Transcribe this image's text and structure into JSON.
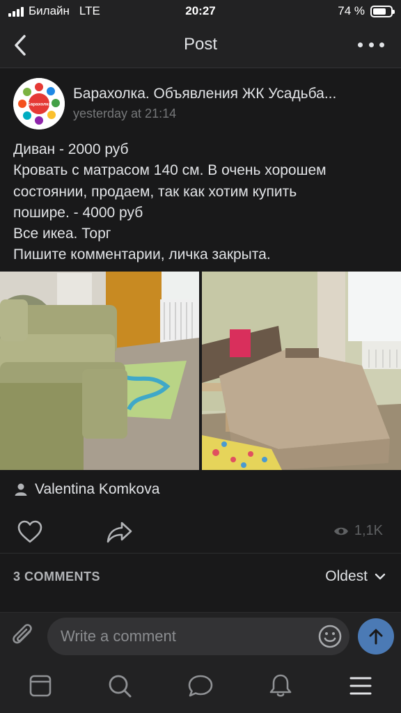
{
  "status_bar": {
    "carrier": "Билайн",
    "network": "LTE",
    "time": "20:27",
    "battery_text": "74 %",
    "battery_level": 0.74
  },
  "nav": {
    "title": "Post"
  },
  "post": {
    "group_name": "Барахолка. Объявления ЖК Усадьба...",
    "time": "yesterday at 21:14",
    "text_lines": [
      "Диван - 2000 руб",
      "Кровать с матрасом 140 см. В очень хорошем",
      "состоянии, продаем, так как хотим купить",
      "пошире. - 4000 руб",
      "Все икеа. Торг",
      "Пишите комментарии, личка закрыта."
    ],
    "avatar_logo_text": "Барахолка",
    "author": "Valentina Komkova",
    "views": "1,1K"
  },
  "comments": {
    "count_label": "3 COMMENTS",
    "sort_label": "Oldest"
  },
  "composer": {
    "placeholder": "Write a comment"
  },
  "colors": {
    "background": "#19191a",
    "bar": "#222223",
    "accent": "#4b7ab5",
    "text": "#e1e3e6",
    "secondary": "#76787a"
  },
  "icons": {
    "back": "chevron-left-icon",
    "more": "more-dots-icon",
    "like": "heart-icon",
    "share": "share-arrow-icon",
    "views": "eye-icon",
    "attach": "paperclip-icon",
    "emoji": "smiley-icon",
    "send": "arrow-up-icon",
    "tabs": [
      "news-icon",
      "search-icon",
      "messages-icon",
      "notifications-icon",
      "menu-icon"
    ]
  }
}
